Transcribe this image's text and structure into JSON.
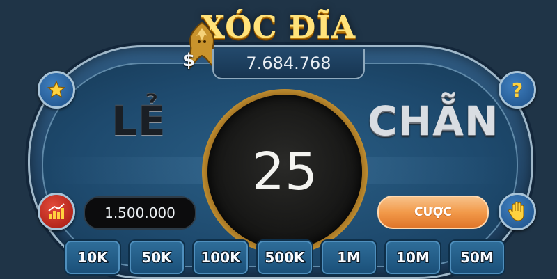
{
  "game": {
    "title": "XÓC ĐĨA",
    "balance_symbol": "$",
    "balance": "7.684.768"
  },
  "table": {
    "odd_label": "LẺ",
    "even_label": "CHẴN",
    "countdown": "25",
    "bet_amount": "1.500.000",
    "bet_button": "CƯỢC"
  },
  "chips": [
    "10K",
    "50K",
    "100K",
    "500K",
    "1M",
    "10M",
    "50M"
  ],
  "icons": {
    "star": "star-icon",
    "help": "question-icon",
    "chart": "chart-icon",
    "hand": "hand-icon",
    "dragon": "dragon-icon"
  },
  "colors": {
    "title": "#ffe27a",
    "bet_button": "#f29a4a",
    "table": "#1e4a6e",
    "chip": "#2f6e9a"
  }
}
